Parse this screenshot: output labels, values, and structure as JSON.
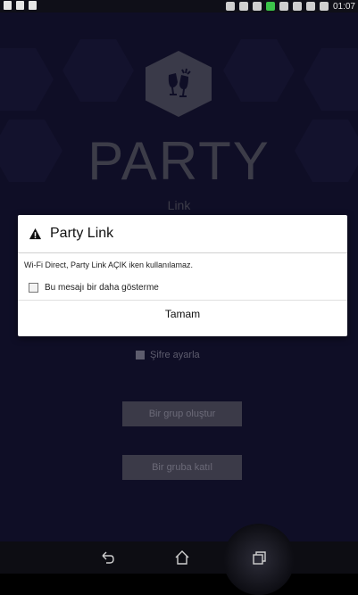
{
  "status_bar": {
    "time": "01:07"
  },
  "background": {
    "title": "PARTY",
    "subtitle": "Link",
    "password_label": "Şifre ayarla",
    "create_group_label": "Bir grup oluştur",
    "join_group_label": "Bir gruba katıl"
  },
  "dialog": {
    "title": "Party Link",
    "message": "Wi-Fi Direct, Party Link AÇIK iken kullanılamaz.",
    "checkbox_label": "Bu mesajı bir daha gösterme",
    "button_label": "Tamam"
  },
  "navbar": {
    "icons": [
      "back-icon",
      "home-icon",
      "recent-apps-icon"
    ]
  }
}
